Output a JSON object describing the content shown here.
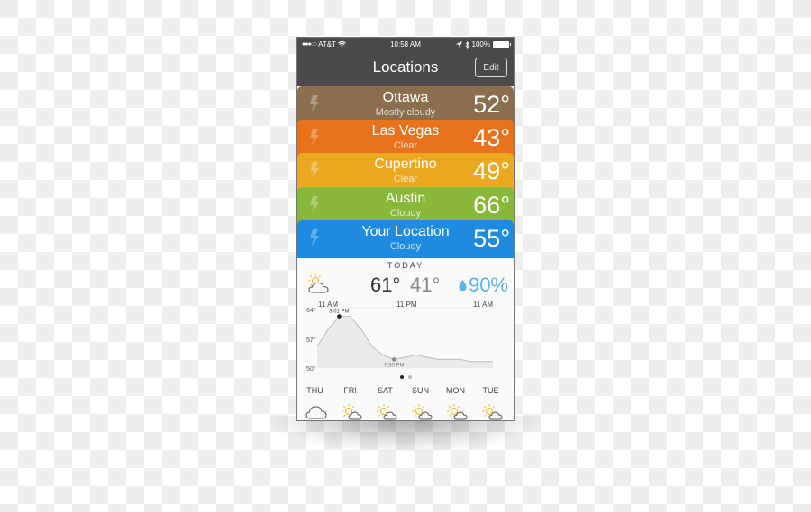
{
  "status_bar": {
    "carrier": "AT&T",
    "signal_dots": "●●●○○",
    "time": "10:58 AM",
    "battery": "100%"
  },
  "header": {
    "title": "Locations",
    "edit_label": "Edit"
  },
  "locations": [
    {
      "name": "Ottawa",
      "condition": "Mostly cloudy",
      "temp": "52°",
      "color": "#8b6e4e"
    },
    {
      "name": "Las Vegas",
      "condition": "Clear",
      "temp": "43°",
      "color": "#e8721c"
    },
    {
      "name": "Cupertino",
      "condition": "Clear",
      "temp": "49°",
      "color": "#eaa920"
    },
    {
      "name": "Austin",
      "condition": "Cloudy",
      "temp": "66°",
      "color": "#88b73a"
    },
    {
      "name": "Your Location",
      "condition": "Cloudy",
      "temp": "55°",
      "color": "#1f8be0"
    }
  ],
  "today": {
    "label": "TODAY",
    "high": "61°",
    "low": "41°",
    "precip": "90%",
    "condition_icon": "partly-cloudy-icon",
    "time_labels": [
      "11 AM",
      "11 PM",
      "11 AM"
    ],
    "chart_y_labels": [
      "64°",
      "57°",
      "50°"
    ],
    "chart_annotations": {
      "max": "3:01 PM",
      "min": "7:50 PM"
    },
    "chart_points": [
      55,
      59,
      62,
      62,
      59,
      55,
      53,
      52,
      52.5,
      53,
      52.5,
      52,
      52,
      52,
      51.5,
      51.5,
      51.5
    ],
    "pager": {
      "count": 2,
      "active": 0
    }
  },
  "forecast": [
    {
      "day": "THU",
      "icon": "cloud-icon"
    },
    {
      "day": "FRI",
      "icon": "partly-cloudy-icon"
    },
    {
      "day": "SAT",
      "icon": "partly-cloudy-icon"
    },
    {
      "day": "SUN",
      "icon": "partly-cloudy-icon"
    },
    {
      "day": "MON",
      "icon": "partly-cloudy-icon"
    },
    {
      "day": "TUE",
      "icon": "partly-cloudy-icon"
    }
  ],
  "colors": {
    "header_bg": "#4a4a4a",
    "precip": "#5ab4e8",
    "sun": "#f0b429"
  }
}
